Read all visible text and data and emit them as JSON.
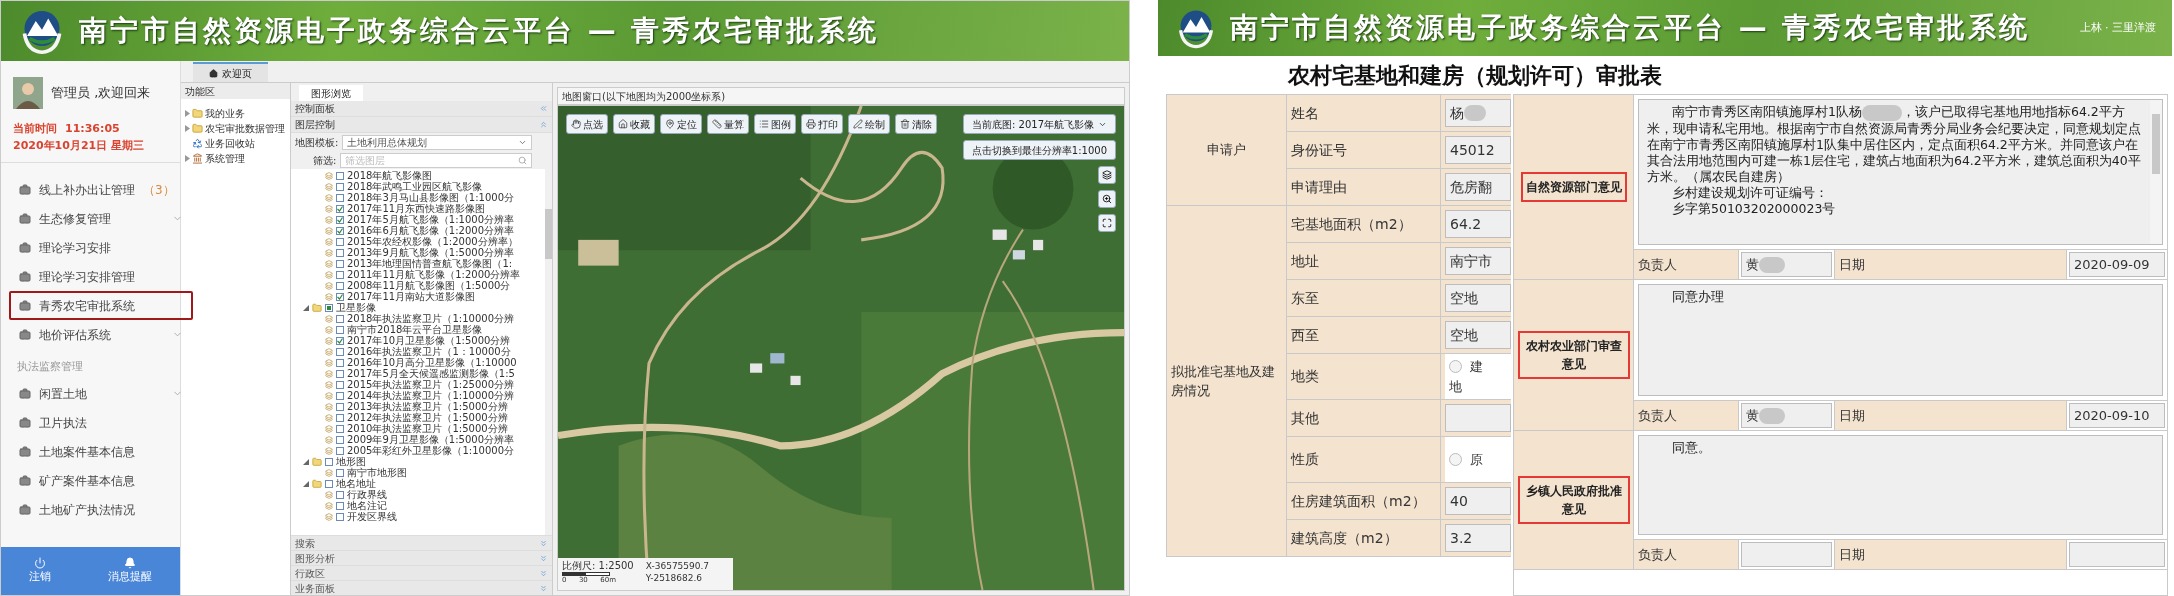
{
  "left_window": {
    "banner": {
      "title": "南宁市自然资源电子政务综合云平台 — 青秀农宅审批系统"
    },
    "user": {
      "greeting": "管理员 ,欢迎回来",
      "time_label": "当前时间",
      "time": "11:36:05",
      "date": "2020年10月21日 星期三"
    },
    "menu": [
      {
        "kind": "item",
        "label": "线上补办出让管理",
        "badge": "（3）",
        "expandable": false,
        "highlighted": false
      },
      {
        "kind": "item",
        "label": "生态修复管理",
        "expandable": true,
        "highlighted": false
      },
      {
        "kind": "item",
        "label": "理论学习安排",
        "expandable": false,
        "highlighted": false
      },
      {
        "kind": "item",
        "label": "理论学习安排管理",
        "expandable": false,
        "highlighted": false
      },
      {
        "kind": "item",
        "label": "青秀农宅审批系统",
        "expandable": false,
        "highlighted": true
      },
      {
        "kind": "item",
        "label": "地价评估系统",
        "expandable": true,
        "highlighted": false
      },
      {
        "kind": "section",
        "label": "执法监察管理"
      },
      {
        "kind": "item",
        "label": "闲置土地",
        "expandable": true,
        "highlighted": false
      },
      {
        "kind": "item",
        "label": "卫片执法",
        "expandable": false,
        "highlighted": false
      },
      {
        "kind": "item",
        "label": "土地案件基本信息",
        "expandable": false,
        "highlighted": false
      },
      {
        "kind": "item",
        "label": "矿产案件基本信息",
        "expandable": false,
        "highlighted": false
      },
      {
        "kind": "item",
        "label": "土地矿产执法情况",
        "expandable": false,
        "highlighted": false
      }
    ],
    "bottom_buttons": [
      {
        "label": "注销"
      },
      {
        "label": "消息提醒"
      }
    ],
    "tabs": [
      {
        "label": "欢迎页",
        "selected": true
      }
    ],
    "function_panel": {
      "title": "功能区",
      "items": [
        {
          "label": "我的业务",
          "expandable": true
        },
        {
          "label": "农宅审批数据管理",
          "expandable": true
        },
        {
          "label": "业务回收站",
          "expandable": false
        },
        {
          "label": "系统管理",
          "expandable": true
        }
      ]
    },
    "map_tabs": [
      {
        "label": "图形浏览",
        "selected": true
      }
    ],
    "control_panel": {
      "title": "控制面板",
      "layer_control": "图层控制",
      "template_label": "地图模板:",
      "template_value": "土地利用总体规划",
      "filter_label": "筛选:",
      "filter_placeholder": "筛选图层",
      "layers": [
        {
          "kind": "leaf",
          "label": "2018年航飞影像图",
          "checked": false
        },
        {
          "kind": "leaf",
          "label": "2018年武鸣工业园区航飞影像",
          "checked": false
        },
        {
          "kind": "leaf",
          "label": "2018年3月马山县影像图（1:1000分",
          "checked": false
        },
        {
          "kind": "leaf",
          "label": "2017年11月东西快速路影像图",
          "checked": true
        },
        {
          "kind": "leaf",
          "label": "2017年5月航飞影像（1:1000分辨率",
          "checked": true
        },
        {
          "kind": "leaf",
          "label": "2016年6月航飞影像（1:2000分辨率",
          "checked": true
        },
        {
          "kind": "leaf",
          "label": "2015年农经权影像（1:2000分辨率）",
          "checked": false
        },
        {
          "kind": "leaf",
          "label": "2013年9月航飞影像（1:5000分辨率",
          "checked": false
        },
        {
          "kind": "leaf",
          "label": "2013年地理国情普查航飞影像图（1:",
          "checked": false
        },
        {
          "kind": "leaf",
          "label": "2011年11月航飞影像（1:2000分辨率",
          "checked": false
        },
        {
          "kind": "leaf",
          "label": "2008年11月航飞影像图（1:5000分",
          "checked": false
        },
        {
          "kind": "leaf",
          "label": "2017年11月南站大道影像图",
          "checked": true
        },
        {
          "kind": "group",
          "label": "卫星影像",
          "partial": true,
          "expanded": true,
          "children": [
            {
              "kind": "leaf",
              "label": "2018年执法监察卫片（1:10000分辨",
              "checked": false
            },
            {
              "kind": "leaf",
              "label": "南宁市2018年云平台卫星影像",
              "checked": false
            },
            {
              "kind": "leaf",
              "label": "2017年10月卫星影像（1:5000分辨",
              "checked": true
            },
            {
              "kind": "leaf",
              "label": "2016年执法监察卫片（1：10000分",
              "checked": false
            },
            {
              "kind": "leaf",
              "label": "2016年10月高分卫星影像（1:10000",
              "checked": false
            },
            {
              "kind": "leaf",
              "label": "2017年5月全天候遥感监测影像（1:5",
              "checked": false
            },
            {
              "kind": "leaf",
              "label": "2015年执法监察卫片（1:25000分辨",
              "checked": false
            },
            {
              "kind": "leaf",
              "label": "2014年执法监察卫片（1:10000分辨",
              "checked": false
            },
            {
              "kind": "leaf",
              "label": "2013年执法监察卫片（1:5000分辨",
              "checked": false
            },
            {
              "kind": "leaf",
              "label": "2012年执法监察卫片（1:5000分辨",
              "checked": false
            },
            {
              "kind": "leaf",
              "label": "2010年执法监察卫片（1:5000分辨",
              "checked": false
            },
            {
              "kind": "leaf",
              "label": "2009年9月卫星影像（1:5000分辨率",
              "checked": false
            },
            {
              "kind": "leaf",
              "label": "2005年彩红外卫星影像（1:10000分",
              "checked": false
            }
          ]
        },
        {
          "kind": "group",
          "label": "地形图",
          "partial": false,
          "expanded": true,
          "children": [
            {
              "kind": "leaf",
              "label": "南宁市地形图",
              "checked": false
            }
          ]
        },
        {
          "kind": "group",
          "label": "地名地址",
          "partial": false,
          "expanded": true,
          "children": [
            {
              "kind": "leaf",
              "label": "行政界线",
              "checked": false
            },
            {
              "kind": "leaf",
              "label": "地名注记",
              "checked": false
            },
            {
              "kind": "leaf",
              "label": "开发区界线",
              "checked": false
            }
          ]
        }
      ],
      "accordions": [
        "搜索",
        "图形分析",
        "行政区",
        "业务面板"
      ]
    },
    "map": {
      "title": "地图窗口(以下地图均为2000坐标系)",
      "tools": [
        {
          "label": "点选"
        },
        {
          "label": "收藏"
        },
        {
          "label": "定位"
        },
        {
          "label": "量算"
        },
        {
          "label": "图例"
        },
        {
          "label": "打印"
        },
        {
          "label": "绘制"
        },
        {
          "label": "清除"
        }
      ],
      "basemap": "当前底图: 2017年航飞影像",
      "best_resolution": "点击切换到最佳分辨率1:1000",
      "scale_label": "比例尺: 1:2500",
      "scale_ticks": [
        "0",
        "30",
        "60m"
      ],
      "x": "X-36575590.7",
      "y": "Y-2518682.6"
    }
  },
  "right_window": {
    "banner": {
      "title": "南宁市自然资源电子政务综合云平台 — 青秀农宅审批系统",
      "caption": "上林 · 三里洋渡"
    },
    "form_title": "农村宅基地和建房（规划许可）审批表",
    "groups": [
      {
        "label": "申请户",
        "rows": [
          {
            "label": "姓名",
            "kind": "text",
            "value": "杨",
            "redacted": true
          },
          {
            "label": "身份证号",
            "kind": "text",
            "value": "45012",
            "redacted": false
          },
          {
            "label": "申请理由",
            "kind": "text",
            "value": "危房翻",
            "redacted": false
          }
        ]
      },
      {
        "label": "拟批准宅基地及建房情况",
        "rows": [
          {
            "label": "宅基地面积（m2）",
            "kind": "text",
            "value": "64.2",
            "redacted": false
          },
          {
            "label": "地址",
            "kind": "text",
            "value": "南宁市",
            "redacted": false
          },
          {
            "label": "东至",
            "kind": "text",
            "value": "空地",
            "redacted": false
          },
          {
            "label": "西至",
            "kind": "text",
            "value": "空地",
            "redacted": false
          },
          {
            "label": "地类",
            "kind": "radio",
            "option": "建",
            "option_tail": "地",
            "checked": false
          },
          {
            "label": "其他",
            "kind": "text",
            "redacted": false
          },
          {
            "label": "性质",
            "kind": "radio",
            "option": "原",
            "checked": false
          },
          {
            "label": "住房建筑面积（m2）",
            "kind": "text",
            "value": "40",
            "redacted": false
          },
          {
            "label": "建筑高度（m2）",
            "kind": "text",
            "value": "3.2",
            "redacted": false
          }
        ]
      }
    ],
    "opinions": [
      {
        "label": "自然资源部门意见",
        "boxed": true,
        "paragraph": [
          "南宁市青秀区南阳镇施厚村1队杨",
          "，该户已取得宅基地用地指标64.2平方米，现申请私宅用地。根据南宁市自然资源局青秀分局业务会纪要决定，同意规划定点在南宁市青秀区南阳镇施厚村1队集中居住区内，定点面积64.2平方米。并同意该户在其合法用地范围内可建一栋1层住宅，建筑占地面积为64.2平方米，建筑总面积为40平方米。（属农民自建房）"
        ],
        "redacted": true,
        "lines": [
          "乡村建设规划许可证编号：",
          "乡字第50103202000023号"
        ],
        "scrollbar": true,
        "signer_label": "负责人",
        "signer": "黄",
        "signer_redacted": true,
        "date_label": "日期",
        "date": "2020-09-09"
      },
      {
        "label": "农村农业部门审查意见",
        "boxed": true,
        "paragraph": [
          "同意办理"
        ],
        "redacted": false,
        "scrollbar": false,
        "signer_label": "负责人",
        "signer": "黄",
        "signer_redacted": true,
        "date_label": "日期",
        "date": "2020-09-10"
      },
      {
        "label": "乡镇人民政府批准意见",
        "boxed": true,
        "paragraph": [
          "同意。"
        ],
        "redacted": false,
        "scrollbar": false,
        "signer_label": "负责人",
        "signer_redacted": false,
        "date_label": "日期"
      }
    ]
  }
}
